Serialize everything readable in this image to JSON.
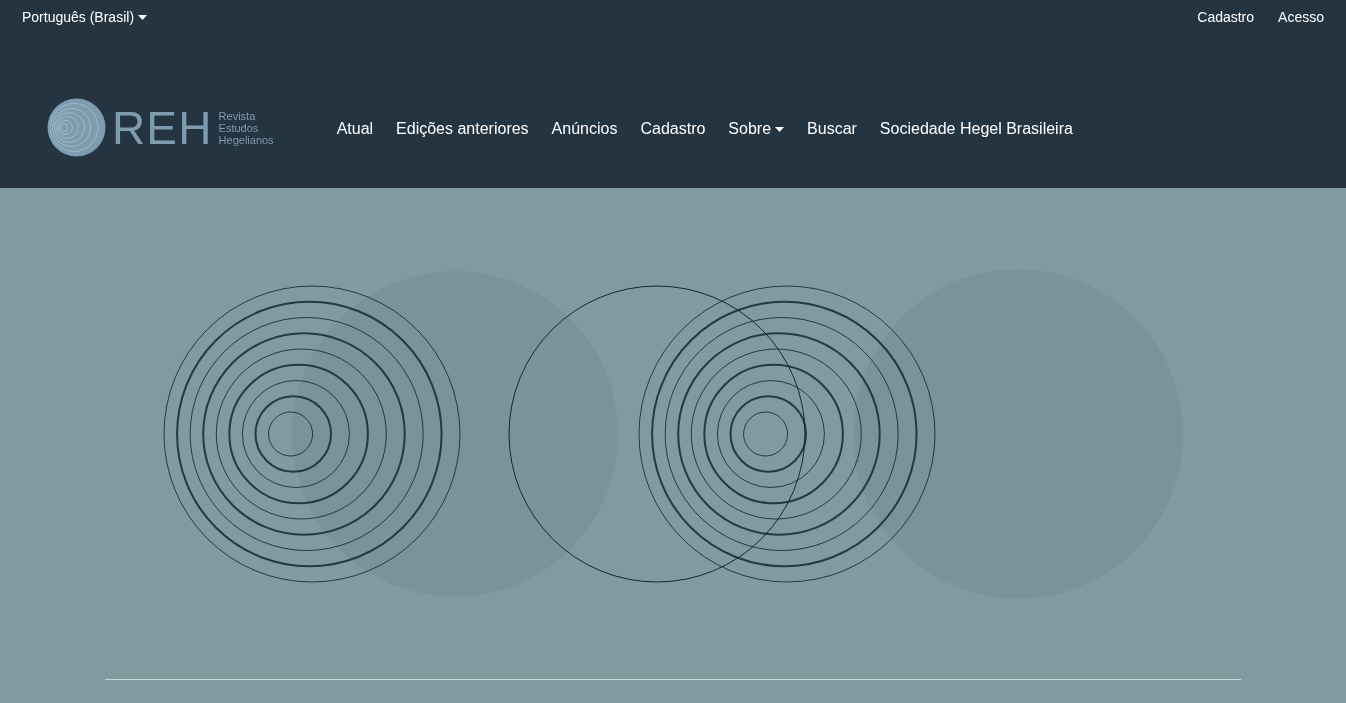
{
  "top_bar": {
    "language": {
      "label": "Português (Brasil)"
    },
    "links": [
      "Cadastro",
      "Acesso"
    ]
  },
  "logo": {
    "mark": "REH",
    "subtitle": [
      "Revista",
      "Estudos",
      "Hegelianos"
    ]
  },
  "nav": [
    {
      "label": "Atual",
      "kind": "link"
    },
    {
      "label": "Edições anteriores",
      "kind": "link"
    },
    {
      "label": "Anúncios",
      "kind": "link"
    },
    {
      "label": "Cadastro",
      "kind": "link"
    },
    {
      "label": "Sobre",
      "kind": "dropdown"
    },
    {
      "label": "Buscar",
      "kind": "link"
    },
    {
      "label": "Sociedade Hegel Brasileira",
      "kind": "link"
    }
  ]
}
